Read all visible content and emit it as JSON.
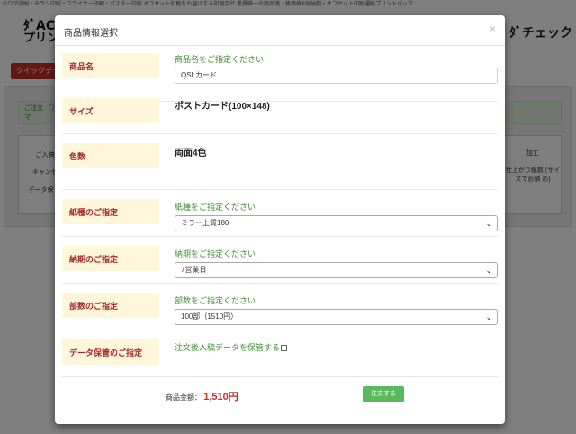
{
  "background": {
    "topline": "クログ印刷・チラシ印刷・フライヤー印刷・ポスター印刷 オフセット印刷をお届けする印刷会社 業界唯一の商品満・格価格&短納期・オフセット印刷通販プリントパック",
    "logo_line1": "ﾀﾞAC印",
    "logo_line2": "プリン",
    "heading_right": "ﾀﾞチェック",
    "quick_button": "クイックデー",
    "notice_left": "ご注文 「注文マ",
    "box_left_title": "ご入稿",
    "box_left_text1": "キャンセ",
    "box_left_text2": "データ保 す",
    "box_right_title": "加工",
    "box_right_text": "仕上がり紙数 (サイズでお納 め)"
  },
  "modal": {
    "title": "商品情報選択",
    "close": "×"
  },
  "rows": {
    "product": {
      "label": "商品名",
      "hint": "商品名をご指定ください",
      "value": "QSLカード"
    },
    "size": {
      "label": "サイズ",
      "value": "ポストカード(100×148)"
    },
    "colors": {
      "label": "色数",
      "value": "両面4色"
    },
    "paper": {
      "label": "紙種のご指定",
      "hint": "紙種をご指定ください",
      "selected": "ミラー上質180"
    },
    "delivery": {
      "label": "納期のご指定",
      "hint": "納期をご指定ください",
      "selected": "7営業日"
    },
    "quantity": {
      "label": "部数のご指定",
      "hint": "部数をご指定ください",
      "selected": "100部（1510円）"
    },
    "storage": {
      "label": "データ保管のご指定",
      "hint": "注文後入稿データを保管する",
      "checked": false
    }
  },
  "footer": {
    "price_label": "商品金額：",
    "price_value": "1,510円",
    "order_button": "注文する"
  }
}
